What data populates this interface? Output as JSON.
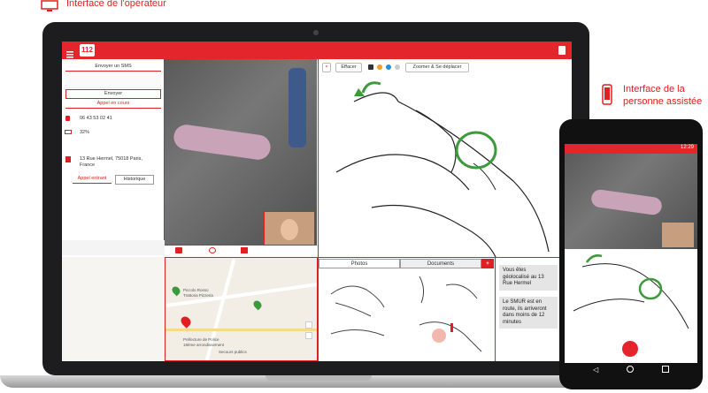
{
  "callouts": {
    "operator": "Interface de l'opérateur",
    "assisted_line1": "Interface de la",
    "assisted_line2": "personne assistée"
  },
  "app": {
    "logo": "112"
  },
  "left_panel": {
    "sms_button": "Envoyer un SMS",
    "send_button": "Envoyer",
    "call_status": "Appel en cours",
    "phone": "06 43 53 02 41",
    "battery": "32%",
    "address_line1": "13 Rue Hermel, 75018 Paris,",
    "address_line2": "France",
    "tab_incoming": "Appel entrant",
    "tab_history": "Historique"
  },
  "drawing_toolbar": {
    "erase": "Effacer",
    "zoom": "Zoomer & Se déplacer",
    "colors": [
      "#333333",
      "#f0a020",
      "#2b8fd6",
      "#cccccc"
    ]
  },
  "media_tabs": {
    "photos": "Photos",
    "documents": "Documents",
    "add": "+"
  },
  "messages": [
    "Vous êtes géolocalisé au 13 Rue Hermel",
    "Le SMUR est en route, ils arriveront dans moins de 12 minutes"
  ],
  "map": {
    "labels": [
      "Piccolo Rosso",
      "Trattoria Pizzeria",
      "Préfecture de Police",
      "18ème arrondissement",
      "Secours publics"
    ]
  },
  "phone": {
    "time": "12:29"
  },
  "colors": {
    "brand_red": "#e4252b",
    "annotation_green": "#3c9a3c"
  }
}
